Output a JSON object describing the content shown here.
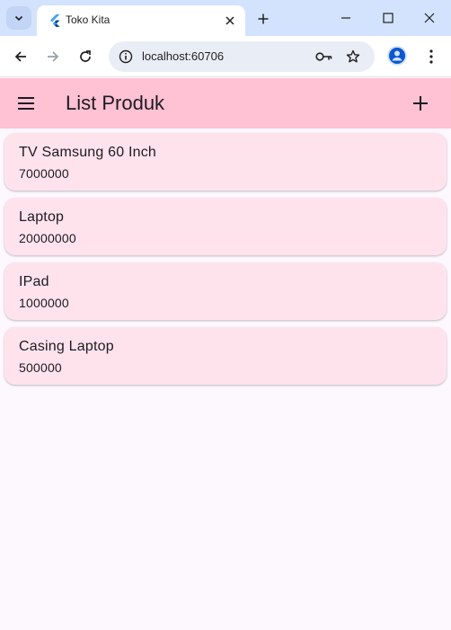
{
  "browser": {
    "tab_title": "Toko Kita",
    "url": "localhost:60706"
  },
  "app": {
    "title": "List Produk",
    "colors": {
      "appbar": "#ffc1d4",
      "card": "#fee3ed",
      "background": "#fdf7fe"
    }
  },
  "products": [
    {
      "name": "TV Samsung 60 Inch",
      "price": "7000000"
    },
    {
      "name": "Laptop",
      "price": "20000000"
    },
    {
      "name": "IPad",
      "price": "1000000"
    },
    {
      "name": "Casing Laptop",
      "price": "500000"
    }
  ],
  "icons": {
    "tab_search": "chevron-down-icon",
    "favicon": "flutter-icon",
    "close": "close-icon",
    "new_tab": "plus-icon",
    "minimize": "minimize-icon",
    "maximize": "maximize-icon",
    "window_close": "close-icon",
    "back": "arrow-left-icon",
    "forward": "arrow-right-icon",
    "reload": "reload-icon",
    "site_info": "info-icon",
    "password": "key-icon",
    "bookmark": "star-icon",
    "profile": "person-icon",
    "menu": "more-vert-icon",
    "drawer": "hamburger-icon",
    "add": "plus-icon"
  }
}
